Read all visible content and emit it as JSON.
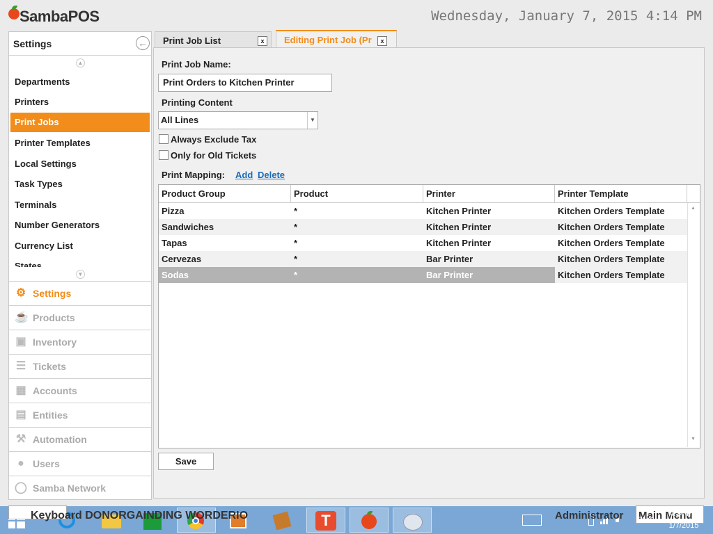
{
  "app": {
    "title": "SambaPOS"
  },
  "clock": "Wednesday, January 7, 2015 4:14 PM",
  "sidebar": {
    "header": "Settings",
    "items": [
      {
        "label": "Departments"
      },
      {
        "label": "Printers"
      },
      {
        "label": "Print Jobs",
        "active": true
      },
      {
        "label": "Printer Templates"
      },
      {
        "label": "Local Settings"
      },
      {
        "label": "Task Types"
      },
      {
        "label": "Terminals"
      },
      {
        "label": "Number Generators"
      },
      {
        "label": "Currency List"
      },
      {
        "label": "States"
      }
    ],
    "nav": [
      {
        "label": "Settings",
        "icon": "gear-icon",
        "active": true
      },
      {
        "label": "Products",
        "icon": "cup-icon"
      },
      {
        "label": "Inventory",
        "icon": "boxes-icon"
      },
      {
        "label": "Tickets",
        "icon": "tickets-icon"
      },
      {
        "label": "Accounts",
        "icon": "calculator-icon"
      },
      {
        "label": "Entities",
        "icon": "grid-icon"
      },
      {
        "label": "Automation",
        "icon": "gavel-icon"
      },
      {
        "label": "Users",
        "icon": "user-icon"
      },
      {
        "label": "Samba Network",
        "icon": "globe-icon"
      }
    ]
  },
  "tabs": [
    {
      "label": "Print Job List",
      "close": "x"
    },
    {
      "label": "Editing Print Job (Pr",
      "close": "x"
    }
  ],
  "form": {
    "name_label": "Print Job Name:",
    "name_value": "Print Orders to Kitchen Printer",
    "content_label": "Printing Content",
    "content_value": "All Lines",
    "exclude_tax_label": "Always Exclude Tax",
    "old_tickets_label": "Only for Old Tickets",
    "mapping_label": "Print Mapping:",
    "add_link": "Add",
    "delete_link": "Delete",
    "save_label": "Save"
  },
  "grid": {
    "columns": [
      "Product Group",
      "Product",
      "Printer",
      "Printer Template"
    ],
    "rows": [
      [
        "Pizza",
        "*",
        "Kitchen Printer",
        "Kitchen Orders Template"
      ],
      [
        "Sandwiches",
        "*",
        "Kitchen Printer",
        "Kitchen Orders Template"
      ],
      [
        "Tapas",
        "*",
        "Kitchen Printer",
        "Kitchen Orders Template"
      ],
      [
        "Cervezas",
        "*",
        "Bar Printer",
        "Kitchen Orders Template"
      ],
      [
        "Sodas",
        "*",
        "Bar Printer",
        "Kitchen Orders Template"
      ]
    ],
    "selected_row": 4
  },
  "taskbar": {
    "overlay_text": "Keyboard DONORGAINDING WORDERIO",
    "user": "Administrator",
    "main_menu": "Main Menu",
    "lang": "ENG",
    "time": "4:14 PM",
    "date": "1/7/2015"
  },
  "colors": {
    "accent": "#f28c1a",
    "link": "#1e6bb8",
    "taskbar": "#7aa7d6"
  }
}
